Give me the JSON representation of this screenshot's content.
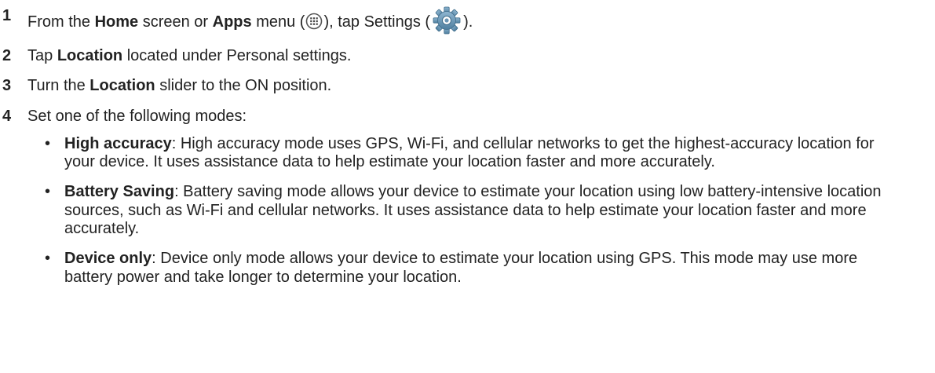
{
  "steps": [
    {
      "number": "1",
      "pre": "From the ",
      "bold1": "Home",
      "mid1": " screen or ",
      "bold2": "Apps",
      "mid2": " menu (",
      "icon1": "apps-icon",
      "mid3": "), tap Settings (",
      "icon2": "settings-gear-icon",
      "post": ")."
    },
    {
      "number": "2",
      "pre": "Tap ",
      "bold": "Location",
      "post": " located under Personal settings."
    },
    {
      "number": "3",
      "pre": "Turn the ",
      "bold": "Location",
      "post": " slider to the ON position."
    },
    {
      "number": "4",
      "text": "Set one of the following modes:"
    }
  ],
  "modes": [
    {
      "bullet": "•",
      "term": "High accuracy",
      "description": ": High accuracy mode uses GPS, Wi-Fi, and cellular networks to get the highest-accuracy location for your device. It uses assistance data to help estimate your location faster and more accurately."
    },
    {
      "bullet": "•",
      "term": "Battery Saving",
      "description": ": Battery saving mode allows your device to estimate your location using low battery-intensive location sources, such as Wi-Fi and cellular networks. It uses assistance data to help estimate your location faster and more accurately."
    },
    {
      "bullet": "•",
      "term": "Device only",
      "description": ": Device only mode allows your device to estimate your location using GPS. This mode may use more battery power and take longer to determine your location."
    }
  ],
  "colors": {
    "text": "#222222",
    "settings_icon_blue": "#5b8fb3",
    "apps_icon_stroke": "#555555"
  }
}
